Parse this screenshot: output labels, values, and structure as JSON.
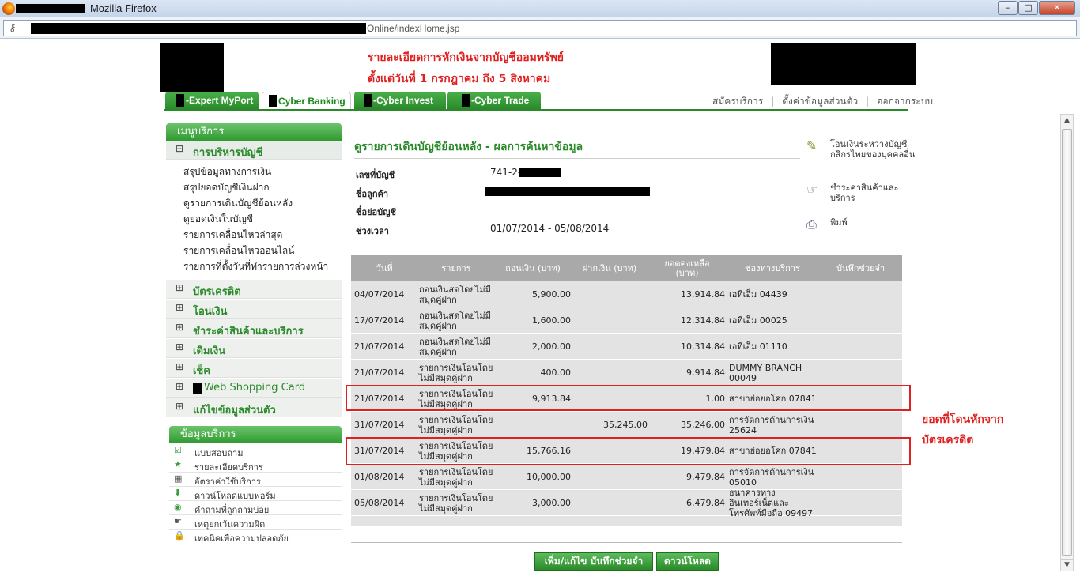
{
  "window": {
    "title": "- Mozilla Firefox",
    "url": "Online/indexHome.jsp",
    "minimize": "–",
    "maximize": "□",
    "close": "✕"
  },
  "notice": {
    "line1": "รายละเอียดการหักเงินจากบัญชีออมทรัพย์",
    "line2": "ตั้งแต่วันที่ 1 กรกฎาคม ถึง 5 สิงหาคม"
  },
  "tabs": [
    {
      "label": "-Expert MyPort"
    },
    {
      "label": "Cyber Banking"
    },
    {
      "label": "-Cyber Invest"
    },
    {
      "label": "-Cyber Trade"
    }
  ],
  "top_links": [
    "สมัครบริการ",
    "|",
    "ตั้งค่าข้อมูลส่วนตัว",
    "|",
    "ออกจากระบบ"
  ],
  "sidebar": {
    "menu_title": "เมนูบริการ",
    "account_section": "การบริหารบัญชี",
    "account_links": [
      "สรุปข้อมูลทางการเงิน",
      "สรุปยอดบัญชีเงินฝาก",
      "ดูรายการเดินบัญชีย้อนหลัง",
      "ดูยอดเงินในบัญชี",
      "รายการเคลื่อนไหวล่าสุด",
      "รายการเคลื่อนไหวออนไลน์",
      "รายการที่ตั้งวันที่ทำรายการล่วงหน้า"
    ],
    "sections": [
      "บัตรเครดิต",
      "โอนเงิน",
      "ชำระค่าสินค้าและบริการ",
      "เติมเงิน",
      "เช็ค",
      "Web Shopping Card",
      "แก้ไขข้อมูลส่วนตัว"
    ],
    "info_title": "ข้อมูลบริการ",
    "info_items": [
      "แบบสอบถาม",
      "รายละเอียดบริการ",
      "อัตราค่าใช้บริการ",
      "ดาวน์โหลดแบบฟอร์ม",
      "คำถามที่ถูกถามบ่อย",
      "เหตุยกเว้นความผิด",
      "เทคนิคเพื่อความปลอดภัย"
    ],
    "plus": "⊞",
    "minus": "⊟"
  },
  "main": {
    "heading": "ดูรายการเดินบัญชีย้อนหลัง - ผลการค้นหาข้อมูล",
    "labels": {
      "account_no": "เลขที่บัญชี",
      "customer": "ชื่อลูกค้า",
      "nickname": "ชื่อย่อบัญชี",
      "period": "ช่วงเวลา"
    },
    "values": {
      "account_no": "741-2-",
      "period": "01/07/2014 - 05/08/2014"
    }
  },
  "quick_links": [
    "โอนเงินระหว่างบัญชีกสิกรไทยของบุคคลอื่น",
    "ชำระค่าสินค้าและบริการ",
    "พิมพ์"
  ],
  "table": {
    "headers": [
      "วันที่",
      "รายการ",
      "ถอนเงิน (บาท)",
      "ฝากเงิน (บาท)",
      "ยอดคงเหลือ (บาท)",
      "ช่องทางบริการ",
      "บันทึกช่วยจำ"
    ],
    "rows": [
      {
        "date": "04/07/2014",
        "desc": "ถอนเงินสดโดยไม่มีสมุดคู่ฝาก",
        "withdraw": "5,900.00",
        "deposit": "",
        "balance": "13,914.84",
        "channel": "เอทีเอ็ม 04439"
      },
      {
        "date": "17/07/2014",
        "desc": "ถอนเงินสดโดยไม่มีสมุดคู่ฝาก",
        "withdraw": "1,600.00",
        "deposit": "",
        "balance": "12,314.84",
        "channel": "เอทีเอ็ม 00025"
      },
      {
        "date": "21/07/2014",
        "desc": "ถอนเงินสดโดยไม่มีสมุดคู่ฝาก",
        "withdraw": "2,000.00",
        "deposit": "",
        "balance": "10,314.84",
        "channel": "เอทีเอ็ม 01110"
      },
      {
        "date": "21/07/2014",
        "desc": "รายการเงินโอนโดยไม่มีสมุดคู่ฝาก",
        "withdraw": "400.00",
        "deposit": "",
        "balance": "9,914.84",
        "channel": "DUMMY BRANCH 00049"
      },
      {
        "date": "21/07/2014",
        "desc": "รายการเงินโอนโดยไม่มีสมุดคู่ฝาก",
        "withdraw": "9,913.84",
        "deposit": "",
        "balance": "1.00",
        "channel": "สาขาย่อยอโศก 07841"
      },
      {
        "date": "31/07/2014",
        "desc": "รายการเงินโอนโดยไม่มีสมุดคู่ฝาก",
        "withdraw": "",
        "deposit": "35,245.00",
        "balance": "35,246.00",
        "channel": "การจัดการด้านการเงิน 25624"
      },
      {
        "date": "31/07/2014",
        "desc": "รายการเงินโอนโดยไม่มีสมุดคู่ฝาก",
        "withdraw": "15,766.16",
        "deposit": "",
        "balance": "19,479.84",
        "channel": "สาขาย่อยอโศก 07841"
      },
      {
        "date": "01/08/2014",
        "desc": "รายการเงินโอนโดยไม่มีสมุดคู่ฝาก",
        "withdraw": "10,000.00",
        "deposit": "",
        "balance": "9,479.84",
        "channel": "การจัดการด้านการเงิน 05010"
      },
      {
        "date": "05/08/2014",
        "desc": "รายการเงินโอนโดยไม่มีสมุดคู่ฝาก",
        "withdraw": "3,000.00",
        "deposit": "",
        "balance": "6,479.84",
        "channel": "ธนาคารทางอินเทอร์เน็ตและโทรศัพท์มือถือ 09497"
      }
    ]
  },
  "buttons": {
    "edit_memo": "เพิ่ม/แก้ไข บันทึกช่วยจำ",
    "download": "ดาวน์โหลด"
  },
  "annotation": {
    "line1": "ยอดที่โดนหักจาก",
    "line2": "บัตรเครดิต"
  },
  "scrollbar": {
    "up": "▲",
    "down": "▼"
  },
  "colors": {
    "accent_green": "#2a8a2a",
    "annotation_red": "#e02020",
    "table_header": "#a9a9a9"
  }
}
